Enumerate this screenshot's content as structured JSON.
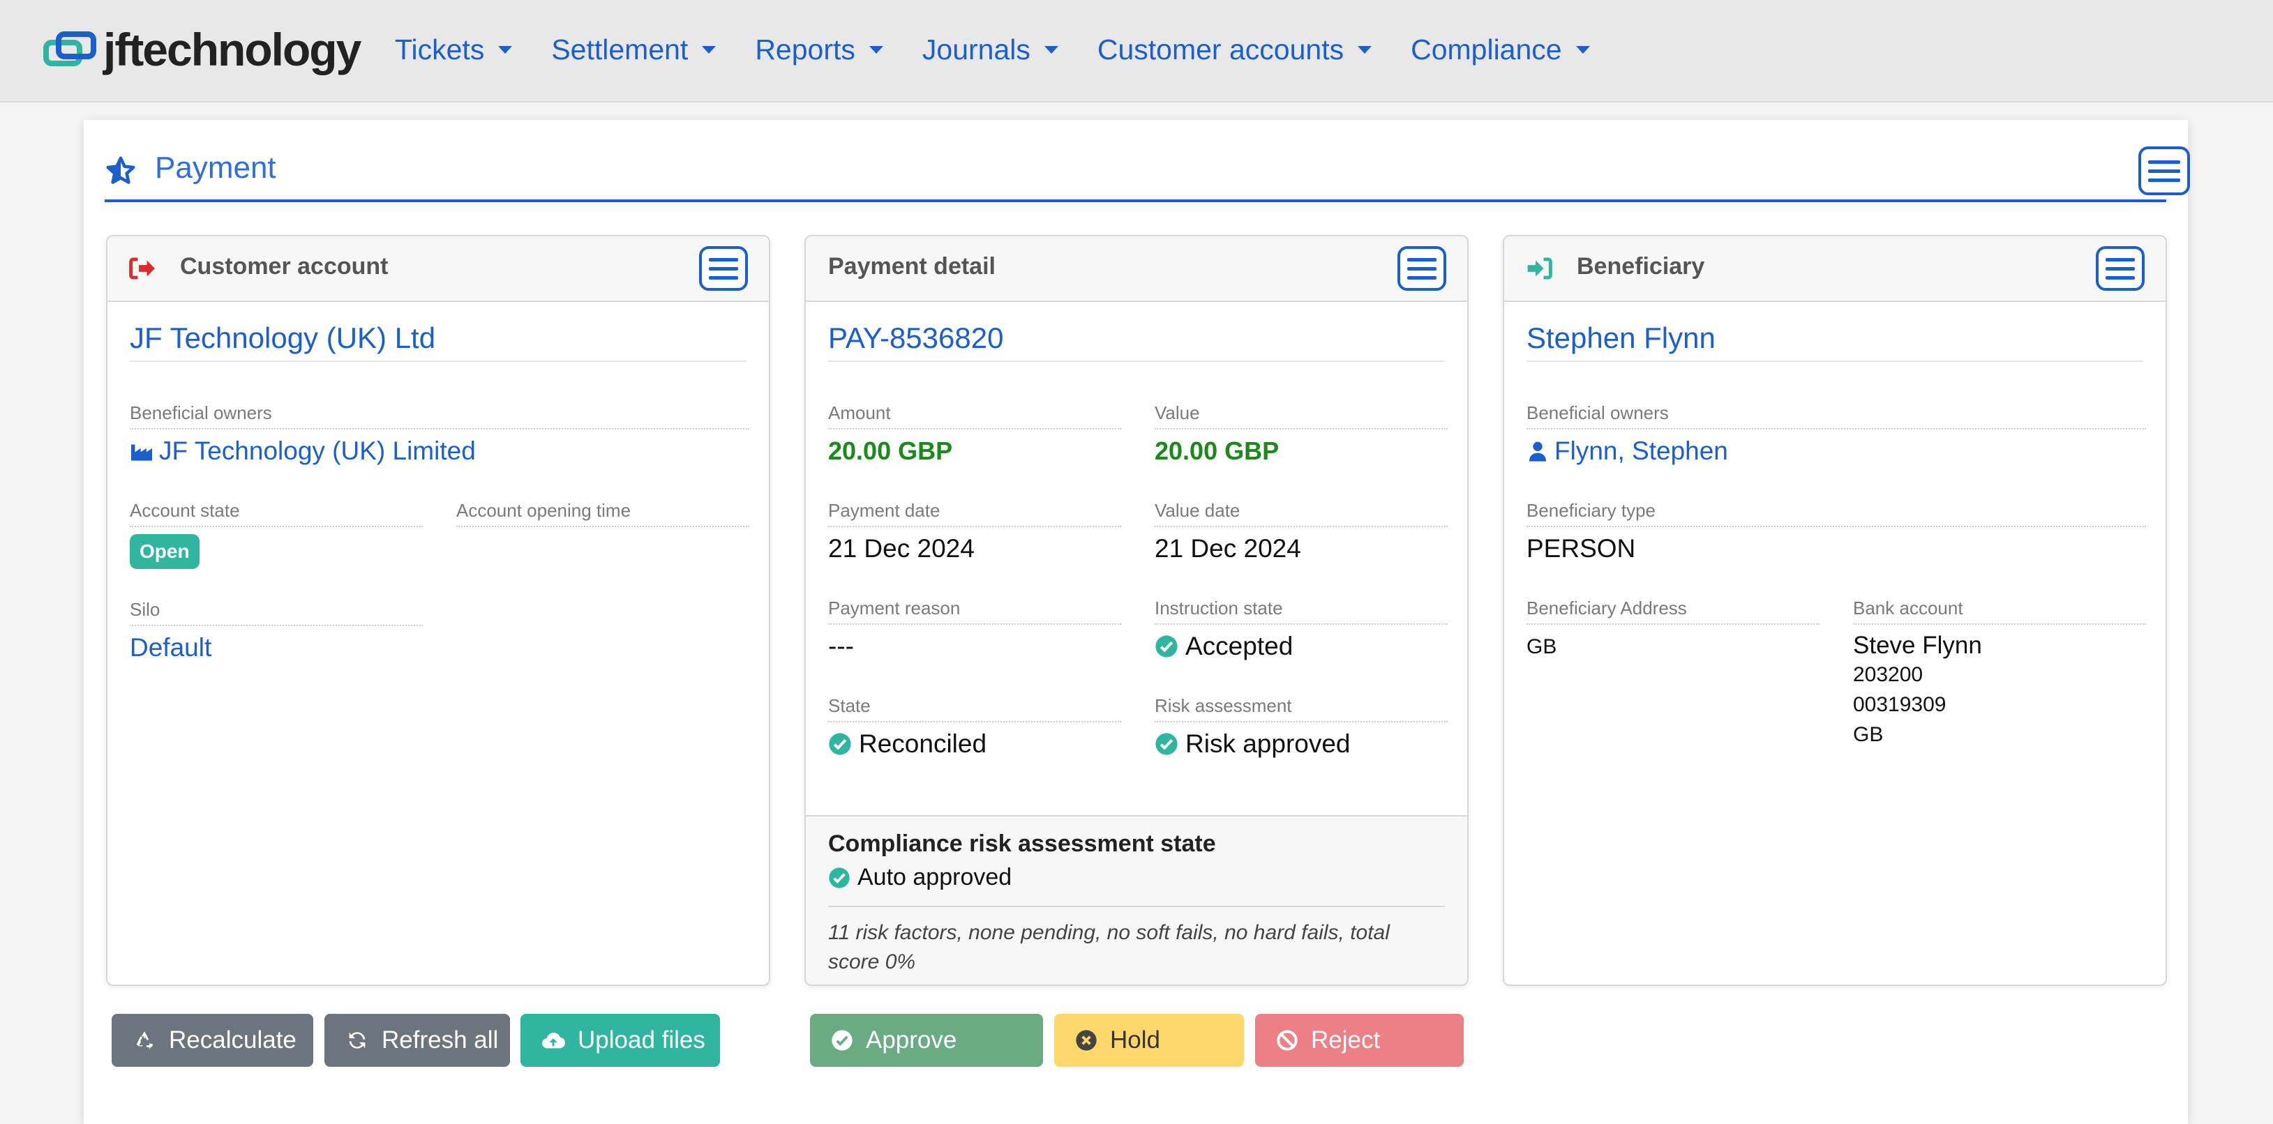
{
  "brand": {
    "name": "jftechnology"
  },
  "nav": [
    {
      "label": "Tickets"
    },
    {
      "label": "Settlement"
    },
    {
      "label": "Reports"
    },
    {
      "label": "Journals"
    },
    {
      "label": "Customer accounts"
    },
    {
      "label": "Compliance"
    }
  ],
  "page": {
    "title": "Payment"
  },
  "customer_account": {
    "heading": "Customer account",
    "name": "JF Technology (UK) Ltd",
    "beneficial_owners_label": "Beneficial owners",
    "beneficial_owner": "JF Technology (UK) Limited",
    "account_state_label": "Account state",
    "account_state": "Open",
    "account_opening_time_label": "Account opening time",
    "silo_label": "Silo",
    "silo": "Default"
  },
  "payment_detail": {
    "heading": "Payment detail",
    "id": "PAY-8536820",
    "amount_label": "Amount",
    "amount": "20.00 GBP",
    "value_label": "Value",
    "value": "20.00 GBP",
    "payment_date_label": "Payment date",
    "payment_date": "21 Dec 2024",
    "value_date_label": "Value date",
    "value_date": "21 Dec 2024",
    "payment_reason_label": "Payment reason",
    "payment_reason": "---",
    "instruction_state_label": "Instruction state",
    "instruction_state": "Accepted",
    "state_label": "State",
    "state": "Reconciled",
    "risk_assessment_label": "Risk assessment",
    "risk_assessment": "Risk approved",
    "compliance_title": "Compliance risk assessment state",
    "compliance_state": "Auto approved",
    "compliance_note": "11 risk factors, none pending, no soft fails, no hard fails, total score 0%"
  },
  "beneficiary": {
    "heading": "Beneficiary",
    "name": "Stephen Flynn",
    "beneficial_owners_label": "Beneficial owners",
    "beneficial_owner": "Flynn, Stephen",
    "type_label": "Beneficiary type",
    "type": "PERSON",
    "address_label": "Beneficiary Address",
    "address": "GB",
    "bank_account_label": "Bank account",
    "bank_account_name": "Steve Flynn",
    "bank_sort_code": "203200",
    "bank_account_number": "00319309",
    "bank_country": "GB"
  },
  "actions": {
    "recalculate": "Recalculate",
    "refresh_all": "Refresh all",
    "upload_files": "Upload files",
    "approve": "Approve",
    "hold": "Hold",
    "reject": "Reject"
  },
  "colors": {
    "primary": "#1b5fcc",
    "teal": "#2fb5a0",
    "green_amount": "#1a8a1a",
    "approve": "#6aab84",
    "hold": "#ffd86b",
    "reject": "#ec8086",
    "grey_button": "#6c757d",
    "danger_icon": "#dc2b2b"
  },
  "icons": [
    "jf-logo-icon",
    "star-icon",
    "menu-icon",
    "sign-out-icon",
    "sign-in-icon",
    "industry-icon",
    "user-icon",
    "check-circle-icon",
    "recycle-icon",
    "refresh-icon",
    "cloud-upload-icon",
    "x-circle-icon",
    "ban-icon"
  ]
}
